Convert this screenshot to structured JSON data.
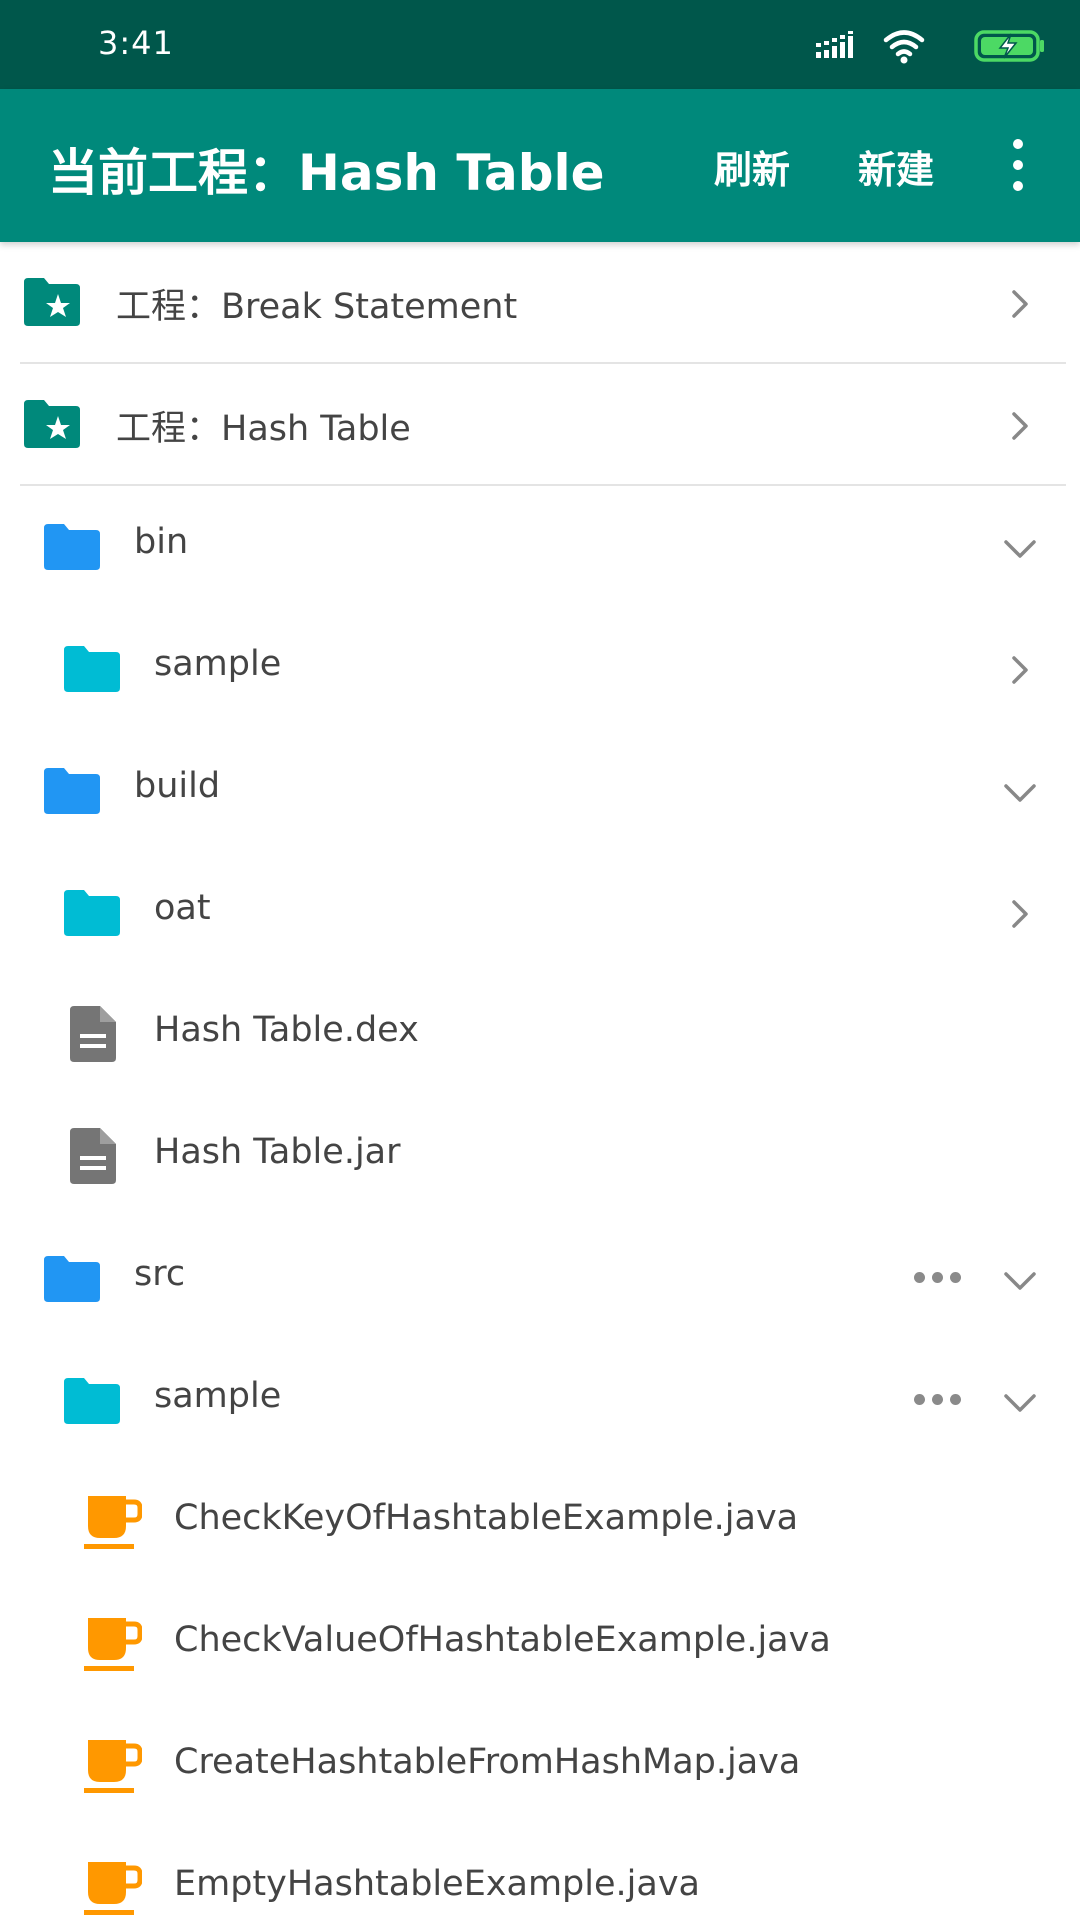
{
  "status_bar": {
    "time": "3:41"
  },
  "app_bar": {
    "title": "当前工程：Hash Table",
    "actions": {
      "refresh": "刷新",
      "new": "新建"
    }
  },
  "colors": {
    "status_bar": "#00574b",
    "app_bar": "#00897b",
    "project_folder": "#00897b",
    "folder_level1": "#2196f3",
    "folder_level2": "#00bcd4",
    "file_icon": "#757575",
    "java_icon": "#ff9800"
  },
  "projects": [
    {
      "label": "工程：Break Statement",
      "icon": "star-folder-icon",
      "indicator": "chevron-right"
    },
    {
      "label": "工程：Hash Table",
      "icon": "star-folder-icon",
      "indicator": "chevron-right"
    }
  ],
  "tree": [
    {
      "label": "bin",
      "icon": "folder-icon",
      "indicator": "chevron-down"
    },
    {
      "label": "sample",
      "icon": "folder-icon",
      "indicator": "chevron-right"
    },
    {
      "label": "build",
      "icon": "folder-icon",
      "indicator": "chevron-down"
    },
    {
      "label": "oat",
      "icon": "folder-icon",
      "indicator": "chevron-right"
    },
    {
      "label": "Hash Table.dex",
      "icon": "file-icon"
    },
    {
      "label": "Hash Table.jar",
      "icon": "file-icon"
    },
    {
      "label": "src",
      "icon": "folder-icon",
      "indicator": "chevron-down",
      "more": "more-horiz-icon"
    },
    {
      "label": "sample",
      "icon": "folder-icon",
      "indicator": "chevron-down",
      "more": "more-horiz-icon"
    },
    {
      "label": "CheckKeyOfHashtableExample.java",
      "icon": "java-cup-icon"
    },
    {
      "label": "CheckValueOfHashtableExample.java",
      "icon": "java-cup-icon"
    },
    {
      "label": "CreateHashtableFromHashMap.java",
      "icon": "java-cup-icon"
    },
    {
      "label": "EmptyHashtableExample.java",
      "icon": "java-cup-icon"
    }
  ]
}
